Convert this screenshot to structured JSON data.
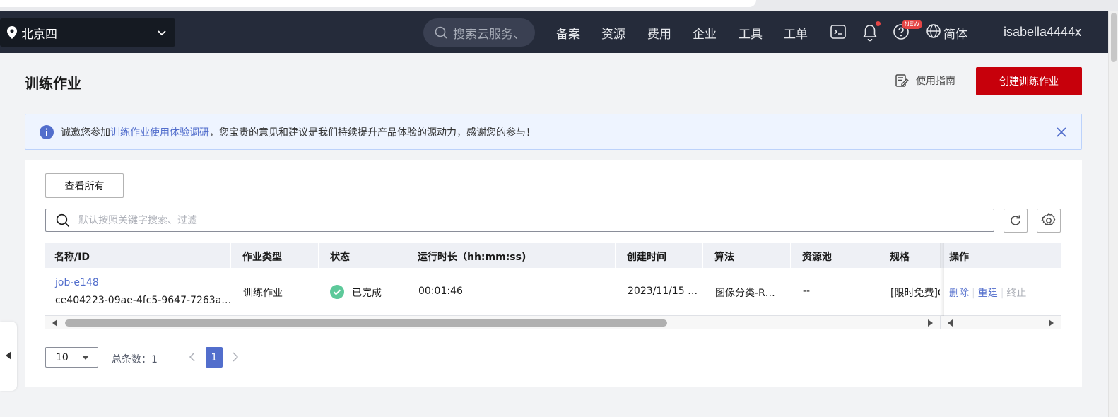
{
  "topnav": {
    "region": "北京四",
    "search_placeholder": "搜索云服务、",
    "items": [
      "备案",
      "资源",
      "费用",
      "企业",
      "工具",
      "工单"
    ],
    "new_badge": "NEW",
    "language": "简体",
    "username": "isabella4444x"
  },
  "header": {
    "title": "训练作业",
    "guide_label": "使用指南",
    "create_label": "创建训练作业"
  },
  "banner": {
    "prefix": "诚邀您参加",
    "link": "训练作业使用体验调研",
    "suffix": "，您宝贵的意见和建议是我们持续提升产品体验的源动力，感谢您的参与！"
  },
  "toolbar": {
    "view_all_label": "查看所有",
    "search_placeholder": "默认按照关键字搜索、过滤"
  },
  "table": {
    "columns": [
      "名称/ID",
      "作业类型",
      "状态",
      "运行时长（hh:mm:ss)",
      "创建时间",
      "算法",
      "资源池",
      "规格",
      "操作"
    ],
    "rows": [
      {
        "name": "job-e148",
        "id": "ce404223-09ae-4fc5-9647-7263a…",
        "type": "训练作业",
        "status": "已完成",
        "duration": "00:01:46",
        "created": "2023/11/15 …",
        "algorithm": "图像分类-R…",
        "pool": "--",
        "spec": "[限时免费]C",
        "actions": [
          "删除",
          "重建",
          "终止"
        ]
      }
    ]
  },
  "pagination": {
    "page_size": "10",
    "total_label": "总条数：1",
    "current_page": "1"
  },
  "colors": {
    "accent_red": "#c7000b",
    "link_blue": "#526ecc",
    "success_green": "#5dc99a",
    "nav_bg": "#252b3a"
  }
}
